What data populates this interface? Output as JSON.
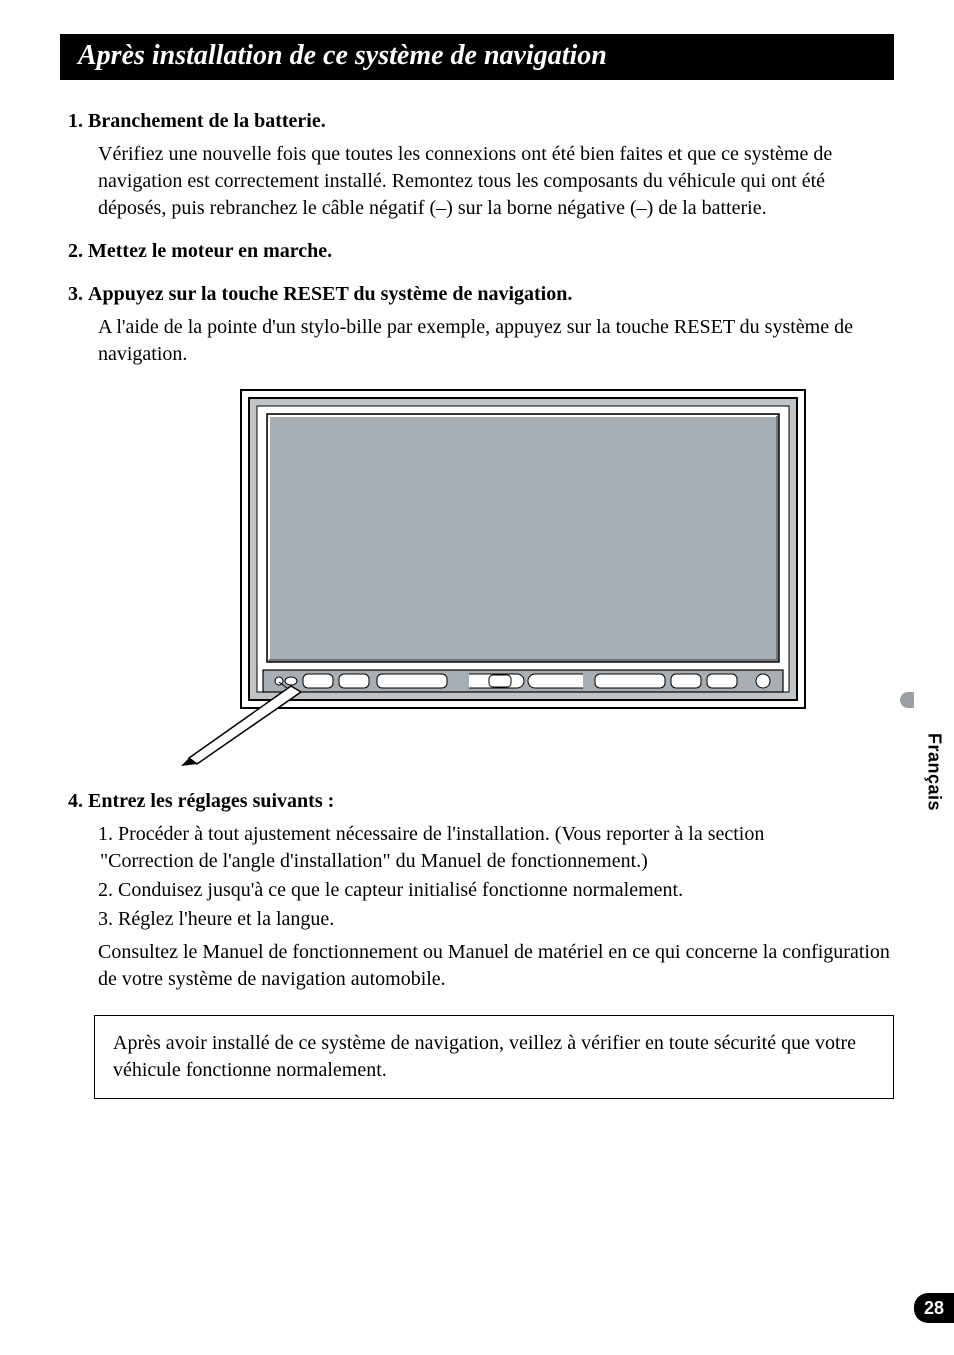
{
  "title": "Après installation de ce système de navigation",
  "steps": [
    {
      "num": "1.",
      "head": "Branchement de la batterie.",
      "body": "Vérifiez une nouvelle fois que toutes les connexions ont été bien faites et que ce système de navigation est correctement installé. Remontez tous les composants du véhicule qui ont été déposés, puis rebranchez le câble négatif (–) sur la borne négative (–) de la batterie."
    },
    {
      "num": "2.",
      "head": "Mettez le moteur en marche."
    },
    {
      "num": "3.",
      "head": "Appuyez sur la touche RESET du système de navigation.",
      "body": "A l'aide de la pointe d'un stylo-bille par exemple, appuyez sur la touche RESET du système de navigation."
    },
    {
      "num": "4.",
      "head": "Entrez les réglages suivants :",
      "sub": [
        {
          "text": "Procéder à tout ajustement nécessaire de l'installation. (Vous reporter à la section",
          "cont": "\"Correction de l'angle d'installation\" du Manuel de fonctionnement.)"
        },
        {
          "text": "Conduisez jusqu'à ce que le capteur initialisé fonctionne normalement."
        },
        {
          "text": "Réglez l'heure et la langue."
        }
      ],
      "post": "Consultez le Manuel de fonctionnement ou Manuel de matériel en ce qui concerne la configuration de votre système de navigation automobile."
    }
  ],
  "note": "Après avoir installé de ce système de navigation, veillez à vérifier en toute sécurité que votre véhicule fonctionne normalement.",
  "language_tab": "Français",
  "page_number": "28"
}
